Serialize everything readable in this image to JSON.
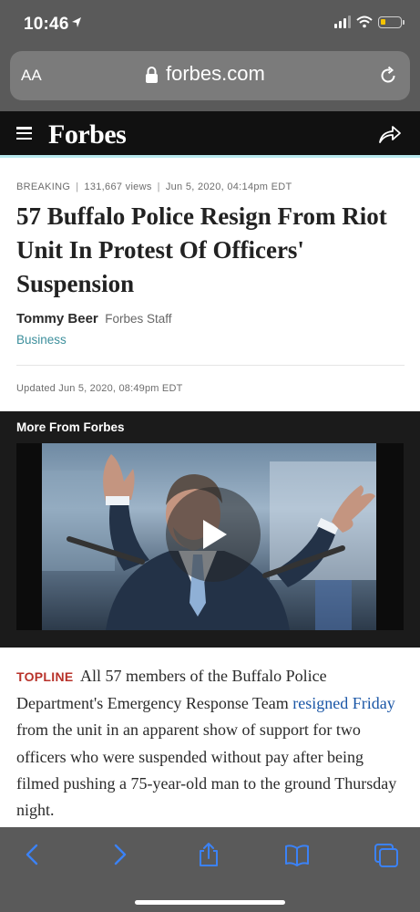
{
  "status_bar": {
    "time": "10:46"
  },
  "browser": {
    "text_size_label": "AA",
    "url": "forbes.com"
  },
  "site": {
    "logo_text": "Forbes"
  },
  "article": {
    "label": "BREAKING",
    "views": "131,667 views",
    "date": "Jun 5, 2020, 04:14pm EDT",
    "headline": "57 Buffalo Police Resign From Riot Unit In Protest Of Officers' Suspension",
    "author": "Tommy Beer",
    "author_role": "Forbes Staff",
    "category": "Business",
    "updated": "Updated Jun 5, 2020, 08:49pm EDT"
  },
  "more_from_forbes": {
    "title": "More From Forbes"
  },
  "body": {
    "topline_label": "TOPLINE",
    "text_before_link": "All 57 members of the Buffalo Police Department's Emergency Response Team",
    "link_text": "resigned Friday",
    "text_after_link": "from the unit in an apparent show of support for two officers who were suspended without pay after being filmed pushing a 75-year-old man to the ground Thursday night."
  },
  "colors": {
    "browser_chrome": "#5a5a5a",
    "forbes_header": "#111111",
    "header_accent": "#b8e9ee",
    "category_link": "#3d8f9c",
    "topline": "#b8322a",
    "body_link": "#1a56a6",
    "toolbar_icon": "#3b82f6"
  },
  "toolbar": {
    "icons": [
      "back-icon",
      "forward-icon",
      "share-icon",
      "bookmarks-icon",
      "tabs-icon"
    ]
  }
}
